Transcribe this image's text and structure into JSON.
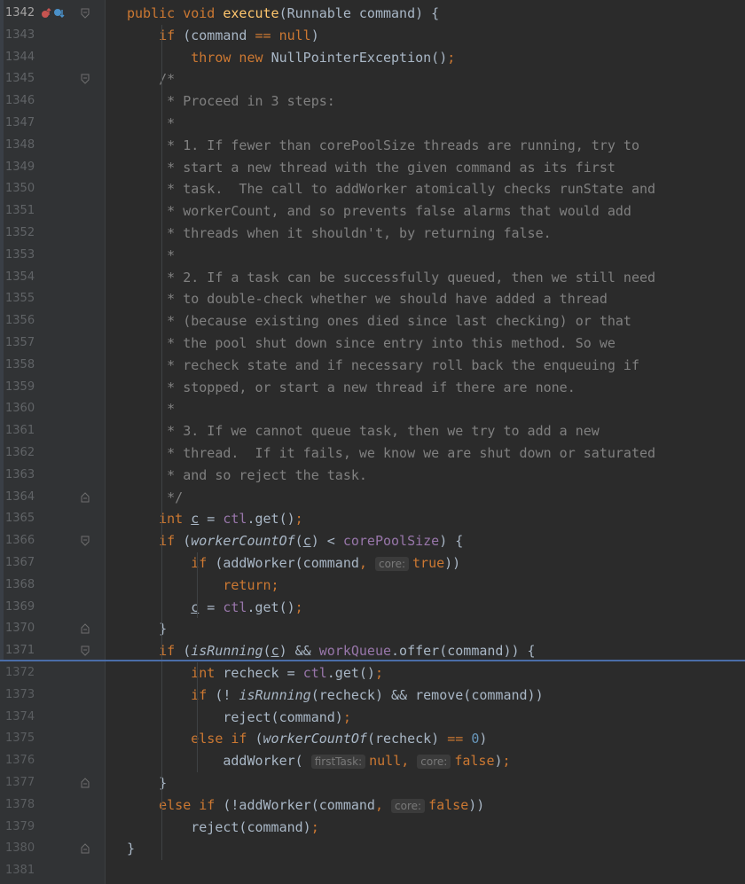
{
  "rows": [
    {
      "ln": "1342",
      "code": [
        [
          "kw",
          "public void "
        ],
        [
          "fn",
          "execute"
        ],
        [
          "",
          "(Runnable command) {"
        ]
      ]
    },
    {
      "ln": "1343",
      "code": [
        [
          "",
          "    "
        ],
        [
          "kw",
          "if "
        ],
        [
          "",
          "(command "
        ],
        [
          "kw",
          "=="
        ],
        [
          "",
          ""
        ],
        [
          "kw",
          " null"
        ],
        [
          "",
          ")"
        ]
      ]
    },
    {
      "ln": "1344",
      "code": [
        [
          "",
          "        "
        ],
        [
          "kw",
          "throw new "
        ],
        [
          "",
          "NullPointerException()"
        ],
        [
          "kw",
          ";"
        ]
      ]
    },
    {
      "ln": "1345",
      "code": [
        [
          "",
          "    "
        ],
        [
          "cm",
          "/*"
        ]
      ]
    },
    {
      "ln": "1346",
      "code": [
        [
          "",
          "     "
        ],
        [
          "cm",
          "* Proceed in 3 steps:"
        ]
      ]
    },
    {
      "ln": "1347",
      "code": [
        [
          "",
          "     "
        ],
        [
          "cm",
          "*"
        ]
      ]
    },
    {
      "ln": "1348",
      "code": [
        [
          "",
          "     "
        ],
        [
          "cm",
          "* 1. If fewer than corePoolSize threads are running, try to"
        ]
      ]
    },
    {
      "ln": "1349",
      "code": [
        [
          "",
          "     "
        ],
        [
          "cm",
          "* start a new thread with the given command as its first"
        ]
      ]
    },
    {
      "ln": "1350",
      "code": [
        [
          "",
          "     "
        ],
        [
          "cm",
          "* task.  The call to addWorker atomically checks runState and"
        ]
      ]
    },
    {
      "ln": "1351",
      "code": [
        [
          "",
          "     "
        ],
        [
          "cm",
          "* workerCount, and so prevents false alarms that would add"
        ]
      ]
    },
    {
      "ln": "1352",
      "code": [
        [
          "",
          "     "
        ],
        [
          "cm",
          "* threads when it shouldn't, by returning false."
        ]
      ]
    },
    {
      "ln": "1353",
      "code": [
        [
          "",
          "     "
        ],
        [
          "cm",
          "*"
        ]
      ]
    },
    {
      "ln": "1354",
      "code": [
        [
          "",
          "     "
        ],
        [
          "cm",
          "* 2. If a task can be successfully queued, then we still need"
        ]
      ]
    },
    {
      "ln": "1355",
      "code": [
        [
          "",
          "     "
        ],
        [
          "cm",
          "* to double-check whether we should have added a thread"
        ]
      ]
    },
    {
      "ln": "1356",
      "code": [
        [
          "",
          "     "
        ],
        [
          "cm",
          "* (because existing ones died since last checking) or that"
        ]
      ]
    },
    {
      "ln": "1357",
      "code": [
        [
          "",
          "     "
        ],
        [
          "cm",
          "* the pool shut down since entry into this method. So we"
        ]
      ]
    },
    {
      "ln": "1358",
      "code": [
        [
          "",
          "     "
        ],
        [
          "cm",
          "* recheck state and if necessary roll back the enqueuing if"
        ]
      ]
    },
    {
      "ln": "1359",
      "code": [
        [
          "",
          "     "
        ],
        [
          "cm",
          "* stopped, or start a new thread if there are none."
        ]
      ]
    },
    {
      "ln": "1360",
      "code": [
        [
          "",
          "     "
        ],
        [
          "cm",
          "*"
        ]
      ]
    },
    {
      "ln": "1361",
      "code": [
        [
          "",
          "     "
        ],
        [
          "cm",
          "* 3. If we cannot queue task, then we try to add a new"
        ]
      ]
    },
    {
      "ln": "1362",
      "code": [
        [
          "",
          "     "
        ],
        [
          "cm",
          "* thread.  If it fails, we know we are shut down or saturated"
        ]
      ]
    },
    {
      "ln": "1363",
      "code": [
        [
          "",
          "     "
        ],
        [
          "cm",
          "* and so reject the task."
        ]
      ]
    },
    {
      "ln": "1364",
      "code": [
        [
          "",
          "     "
        ],
        [
          "cm",
          "*/"
        ]
      ]
    },
    {
      "ln": "1365",
      "code": [
        [
          "",
          "    "
        ],
        [
          "kw",
          "int "
        ],
        [
          "ul",
          "c"
        ],
        [
          "",
          " = "
        ],
        [
          "field",
          "ctl"
        ],
        [
          "",
          ".get()"
        ],
        [
          "kw",
          ";"
        ]
      ]
    },
    {
      "ln": "1366",
      "code": [
        [
          "",
          "    "
        ],
        [
          "kw",
          "if "
        ],
        [
          "",
          "("
        ],
        [
          "italic",
          "workerCountOf"
        ],
        [
          "",
          "("
        ],
        [
          "ul",
          "c"
        ],
        [
          "",
          ") < "
        ],
        [
          "field",
          "corePoolSize"
        ],
        [
          "",
          ") {"
        ]
      ]
    },
    {
      "ln": "1367",
      "code": [
        [
          "",
          "        "
        ],
        [
          "kw",
          "if "
        ],
        [
          "",
          "(addWorker(command"
        ],
        [
          "kw",
          ", "
        ],
        [
          "hint",
          "core:"
        ],
        [
          "kw",
          "true"
        ],
        [
          "",
          "))"
        ]
      ]
    },
    {
      "ln": "1368",
      "code": [
        [
          "",
          "            "
        ],
        [
          "kw",
          "return;"
        ]
      ]
    },
    {
      "ln": "1369",
      "code": [
        [
          "",
          "        "
        ],
        [
          "ul",
          "c"
        ],
        [
          "",
          " = "
        ],
        [
          "field",
          "ctl"
        ],
        [
          "",
          ".get()"
        ],
        [
          "kw",
          ";"
        ]
      ]
    },
    {
      "ln": "1370",
      "code": [
        [
          "",
          "    }"
        ]
      ]
    },
    {
      "ln": "1371",
      "code": [
        [
          "",
          "    "
        ],
        [
          "kw",
          "if "
        ],
        [
          "",
          "("
        ],
        [
          "italic",
          "isRunning"
        ],
        [
          "",
          "("
        ],
        [
          "ul",
          "c"
        ],
        [
          "",
          ") && "
        ],
        [
          "field",
          "workQueue"
        ],
        [
          "",
          ".offer(command)) {"
        ]
      ]
    },
    {
      "ln": "1372",
      "code": [
        [
          "",
          "        "
        ],
        [
          "kw",
          "int "
        ],
        [
          "",
          "recheck = "
        ],
        [
          "field",
          "ctl"
        ],
        [
          "",
          ".get()"
        ],
        [
          "kw",
          ";"
        ]
      ]
    },
    {
      "ln": "1373",
      "code": [
        [
          "",
          "        "
        ],
        [
          "kw",
          "if "
        ],
        [
          "",
          "(! "
        ],
        [
          "italic",
          "isRunning"
        ],
        [
          "",
          "(recheck) && remove(command))"
        ]
      ]
    },
    {
      "ln": "1374",
      "code": [
        [
          "",
          "            reject(command)"
        ],
        [
          "kw",
          ";"
        ]
      ]
    },
    {
      "ln": "1375",
      "code": [
        [
          "",
          "        "
        ],
        [
          "kw",
          "else if "
        ],
        [
          "",
          "("
        ],
        [
          "italic",
          "workerCountOf"
        ],
        [
          "",
          "(recheck) "
        ],
        [
          "kw",
          "=="
        ],
        [
          "",
          " "
        ],
        [
          "num",
          "0"
        ],
        [
          "",
          ")"
        ]
      ]
    },
    {
      "ln": "1376",
      "code": [
        [
          "",
          "            addWorker( "
        ],
        [
          "hint",
          "firstTask:"
        ],
        [
          "kw",
          "null, "
        ],
        [
          "hint",
          "core:"
        ],
        [
          "kw",
          "false"
        ],
        [
          "",
          ")"
        ],
        [
          "kw",
          ";"
        ]
      ]
    },
    {
      "ln": "1377",
      "code": [
        [
          "",
          "    }"
        ]
      ]
    },
    {
      "ln": "1378",
      "code": [
        [
          "",
          "    "
        ],
        [
          "kw",
          "else if "
        ],
        [
          "",
          "(!addWorker(command"
        ],
        [
          "kw",
          ", "
        ],
        [
          "hint",
          "core:"
        ],
        [
          "kw",
          "false"
        ],
        [
          "",
          "))"
        ]
      ]
    },
    {
      "ln": "1379",
      "code": [
        [
          "",
          "        reject(command)"
        ],
        [
          "kw",
          ";"
        ]
      ]
    },
    {
      "ln": "1380",
      "code": [
        [
          "",
          "}"
        ]
      ]
    },
    {
      "ln": "1381",
      "code": []
    }
  ],
  "colors": {
    "background": "#2b2b2b",
    "keyword": "#cc7832",
    "function": "#ffc66d",
    "comment": "#808080",
    "field": "#9876aa",
    "number": "#6897bb",
    "split": "#4a6da8"
  },
  "gutter_icons": {
    "override": "override-up-icon",
    "implemented": "implemented-down-icon"
  }
}
